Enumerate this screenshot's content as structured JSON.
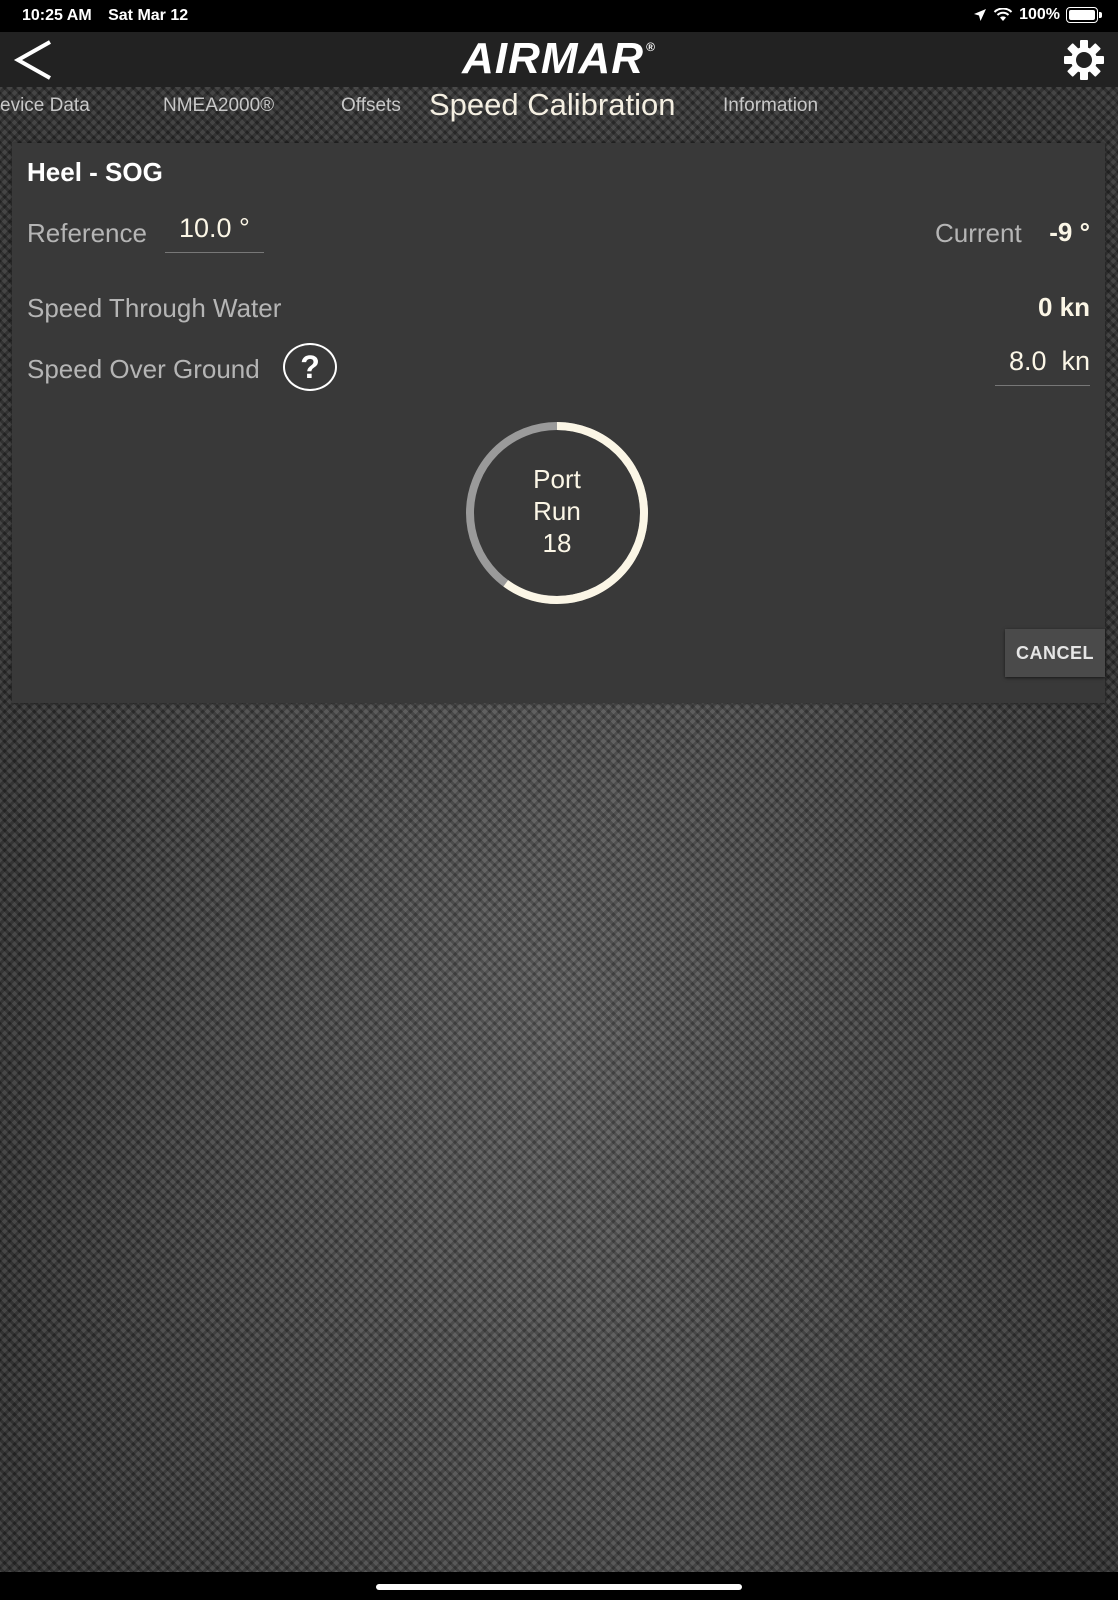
{
  "status_bar": {
    "time": "10:25 AM",
    "date": "Sat Mar 12",
    "battery": "100%",
    "icons": [
      "location-icon",
      "wifi-icon",
      "battery-icon"
    ]
  },
  "header": {
    "logo": "AIRMAR",
    "logo_mark": "®",
    "icons": [
      "back-icon",
      "gear-icon"
    ]
  },
  "tabs": [
    {
      "label": "evice Data"
    },
    {
      "label": "NMEA2000®"
    },
    {
      "label": "Offsets"
    },
    {
      "label": "Speed Calibration",
      "active": true
    },
    {
      "label": "Information"
    }
  ],
  "panel": {
    "title": "Heel - SOG",
    "reference_label": "Reference",
    "reference_value": "10.0 °",
    "current_label": "Current",
    "current_value": "-9 °",
    "stw_label": "Speed Through Water",
    "stw_value": "0 kn",
    "sog_label": "Speed Over Ground",
    "sog_value": "8.0  kn",
    "help_symbol": "?",
    "progress": {
      "line1": "Port",
      "line2": "Run",
      "line3": "18",
      "fraction_complete": 0.6
    },
    "cancel_label": "CANCEL"
  },
  "colors": {
    "accent": "#fbf6e6",
    "ring_track": "#9a9a9a",
    "panel": "#393939"
  }
}
